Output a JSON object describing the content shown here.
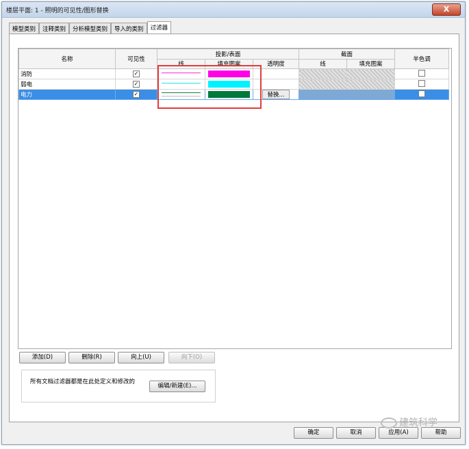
{
  "window": {
    "title": "楼层平面: 1 - 照明的可见性/图形替换",
    "close_label": "X"
  },
  "tabs": [
    "模型类别",
    "注释类别",
    "分析模型类别",
    "导入的类别",
    "过滤器"
  ],
  "active_tab": 4,
  "table": {
    "headers": {
      "name": "名称",
      "visibility": "可见性",
      "projection_surface": "投影/表面",
      "line": "线",
      "fill_pattern": "填充图案",
      "transparency": "透明度",
      "cut": "截面",
      "cut_line": "线",
      "cut_fill_pattern": "填充图案",
      "halftone": "半色调"
    },
    "rows": [
      {
        "name": "消防",
        "visible": "✓",
        "line_color": "#ff2ad4",
        "fill_color": "#ff00e6",
        "transparency": "",
        "halftone": ""
      },
      {
        "name": "弱电",
        "visible": "✓",
        "line_color": "#22e0f2",
        "fill_color": "#00f2ff",
        "transparency": "",
        "halftone": ""
      },
      {
        "name": "电力",
        "visible": "✓",
        "line_color": "#1d7a44",
        "fill_color": "#007a3c",
        "transparency": "替换...",
        "halftone": ""
      }
    ],
    "selected_row": 2
  },
  "filter_buttons": {
    "add": "添加(D)",
    "delete": "删除(R)",
    "up": "向上(U)",
    "down": "向下(O)"
  },
  "note": {
    "text": "所有文档过滤器都是在此处定义和修改的",
    "edit_button": "编辑/新建(E)..."
  },
  "bottom_buttons": {
    "ok": "确定",
    "cancel": "取消",
    "apply": "应用(A)",
    "help": "帮助"
  },
  "watermark": "建筑科学",
  "colors": {
    "selection": "#3a8ee6",
    "annotation_box": "#e23c3c"
  }
}
